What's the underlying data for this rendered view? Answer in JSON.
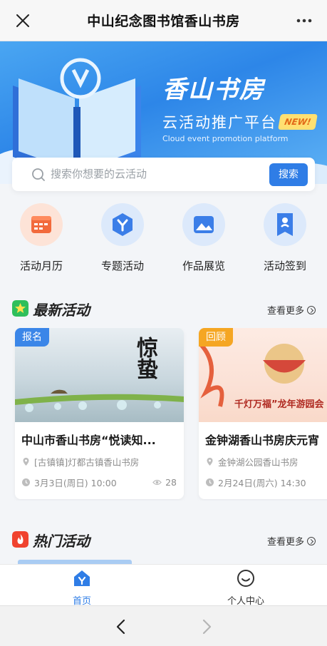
{
  "window": {
    "title": "中山纪念图书馆香山书房"
  },
  "hero": {
    "brand": "香山书房",
    "subtitle": "云活动推广平台",
    "subtitle_en": "Cloud event promotion platform",
    "badge": "NEW!"
  },
  "search": {
    "placeholder": "搜索你想要的云活动",
    "button_label": "搜索"
  },
  "quick_nav": [
    {
      "label": "活动月历",
      "icon": "calendar-icon",
      "color": "#f26a3c"
    },
    {
      "label": "专题活动",
      "icon": "topic-icon",
      "color": "#3b7ee8"
    },
    {
      "label": "作品展览",
      "icon": "gallery-icon",
      "color": "#3b7ee8"
    },
    {
      "label": "活动签到",
      "icon": "checkin-icon",
      "color": "#3b7ee8"
    }
  ],
  "latest": {
    "title": "最新活动",
    "more_label": "查看更多",
    "cards": [
      {
        "badge": "报名",
        "image_text": "惊蛰",
        "title": "中山市香山书房“悦读知...",
        "location": "[古镇镇]灯都古镇香山书房",
        "time": "3月3日(周日) 10:00",
        "views": "28"
      },
      {
        "badge": "回顾",
        "image_text": "千灯万福”龙年游园会",
        "title": "金钟湖香山书房庆元宵",
        "location": "金钟湖公园香山书房",
        "time": "2月24日(周六) 14:30"
      }
    ]
  },
  "hot": {
    "title": "热门活动",
    "more_label": "查看更多"
  },
  "tabbar": [
    {
      "label": "首页",
      "active": true
    },
    {
      "label": "个人中心",
      "active": false
    }
  ],
  "colors": {
    "primary": "#2f7de6",
    "accent_orange": "#f26a3c",
    "badge_blue": "#3b86e8",
    "badge_orange": "#f5a623"
  }
}
